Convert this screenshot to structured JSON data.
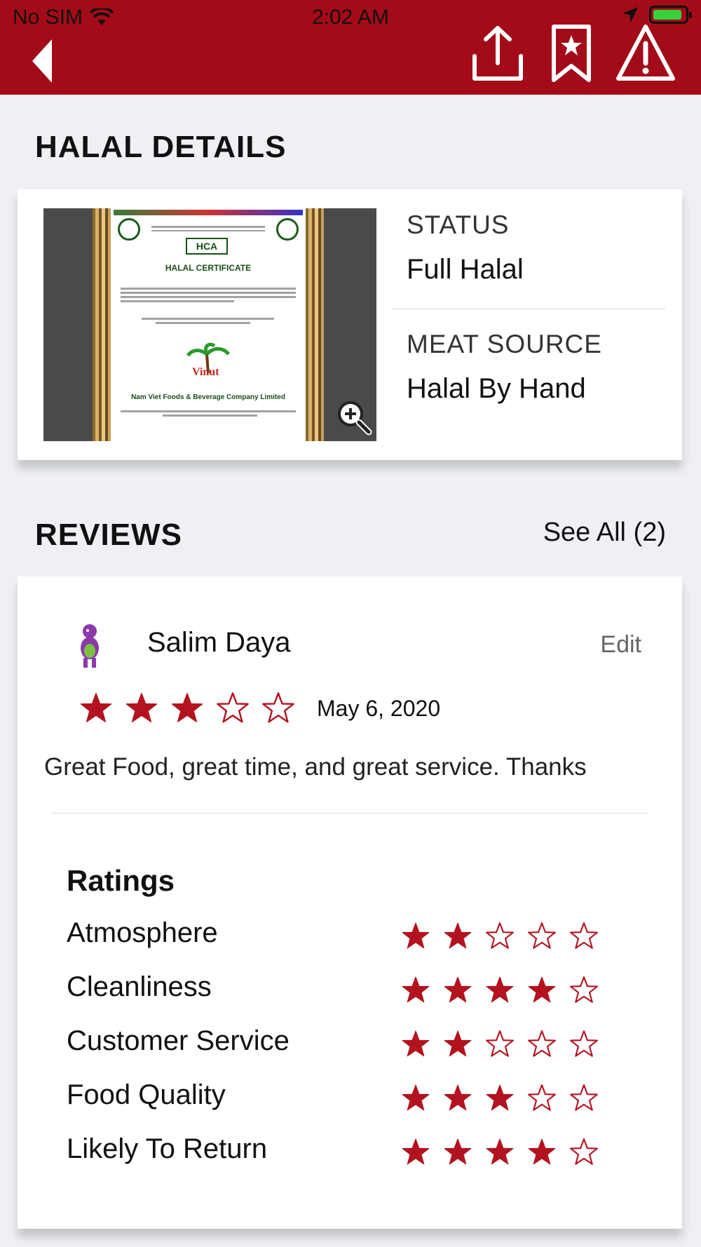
{
  "status_bar": {
    "carrier": "No SIM",
    "time": "2:02 AM"
  },
  "header": {
    "background_color": "#a30b18",
    "icons": [
      "back-arrow-icon",
      "share-icon",
      "bookmark-star-icon",
      "warning-icon"
    ]
  },
  "halal_details": {
    "section_title": "HALAL DETAILS",
    "certificate": {
      "heading": "HALAL CERTIFICATE",
      "agency_logo": "HCA",
      "company": "Nam Viet Foods & Beverage Company Limited"
    },
    "status_label": "STATUS",
    "status_value": "Full Halal",
    "meat_source_label": "MEAT SOURCE",
    "meat_source_value": "Halal By Hand"
  },
  "reviews": {
    "section_title": "REVIEWS",
    "see_all": "See All (2)",
    "review": {
      "reviewer": "Salim Daya",
      "edit_label": "Edit",
      "rating": 3,
      "date": "May 6, 2020",
      "text": "Great Food, great time, and great service. Thanks"
    },
    "ratings_title": "Ratings",
    "ratings": [
      {
        "label": "Atmosphere",
        "stars": 2
      },
      {
        "label": "Cleanliness",
        "stars": 4
      },
      {
        "label": "Customer Service",
        "stars": 2
      },
      {
        "label": "Food Quality",
        "stars": 3
      },
      {
        "label": "Likely To Return",
        "stars": 4
      }
    ],
    "max_stars": 5,
    "star_color": "#b3121f"
  }
}
